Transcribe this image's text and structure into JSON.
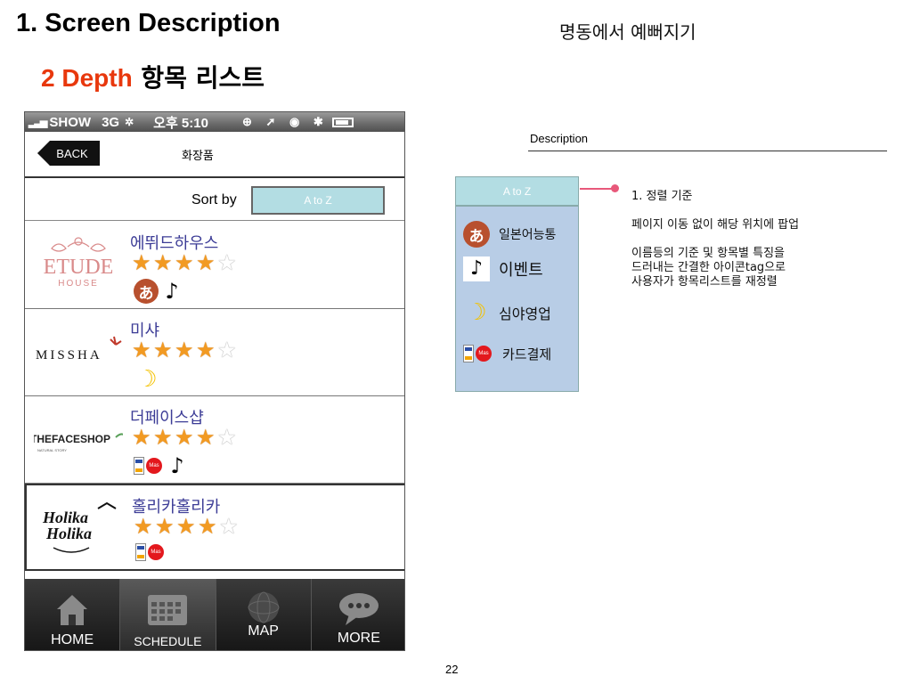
{
  "slide": {
    "title": "1. Screen Description",
    "top_right": "명동에서 예뻐지기",
    "subtitle_accent": "2 Depth",
    "subtitle_rest": " 항목 리스트",
    "page_number": "22"
  },
  "statusbar": {
    "signal": "▂▃▅",
    "carrier": "SHOW",
    "network": "3G",
    "activity": "✲",
    "time": "오후 5:10",
    "icons": "⊕ ➚ ◉ ✱"
  },
  "navbar": {
    "back_label": "BACK",
    "title": "화장품"
  },
  "sort": {
    "label": "Sort by",
    "selected": "A to Z"
  },
  "items": [
    {
      "name": "에뛰드하우스",
      "logo_text": "ETUDE",
      "logo_sub": "HOUSE",
      "rating": 4,
      "tags": [
        "japanese-icon",
        "music-note-icon"
      ]
    },
    {
      "name": "미샤",
      "logo_text": "MISSHA",
      "rating": 4,
      "tags": [
        "moon-icon"
      ]
    },
    {
      "name": "더페이스샵",
      "logo_text": "THEFACESHOP",
      "logo_sub": "NATURAL STORY",
      "rating": 4,
      "tags": [
        "card-icon",
        "music-note-icon"
      ]
    },
    {
      "name": "홀리카홀리카",
      "logo_text": "Holika",
      "logo_sub": "Holika",
      "rating": 4,
      "tags": [
        "card-icon"
      ]
    }
  ],
  "tabbar": [
    {
      "label": "HOME",
      "icon": "home-icon"
    },
    {
      "label": "SCHEDULE",
      "icon": "calendar-icon"
    },
    {
      "label": "MAP",
      "icon": "map-icon"
    },
    {
      "label": "MORE",
      "icon": "more-icon"
    }
  ],
  "description": {
    "header": "Description",
    "popup_head": "A to Z",
    "popup_items": [
      {
        "label": "일본어능통",
        "icon": "japanese-icon"
      },
      {
        "label": "이벤트",
        "icon": "music-note-icon"
      },
      {
        "label": "심야영업",
        "icon": "moon-icon"
      },
      {
        "label": "카드결제",
        "icon": "card-icon"
      }
    ],
    "line1": "1. 정렬 기준",
    "line2": "페이지 이동 없이 해당 위치에 팝업",
    "line3": " 이름등의 기준 및 항목별 특징을\n드러내는 간결한 아이콘tag으로\n사용자가 항목리스트를 재정렬"
  },
  "colors": {
    "accent": "#e8380d",
    "sort_bg": "#b3dde3",
    "popup_bg": "#b8cde6",
    "star": "#f29a22",
    "connector": "#e8587a"
  }
}
